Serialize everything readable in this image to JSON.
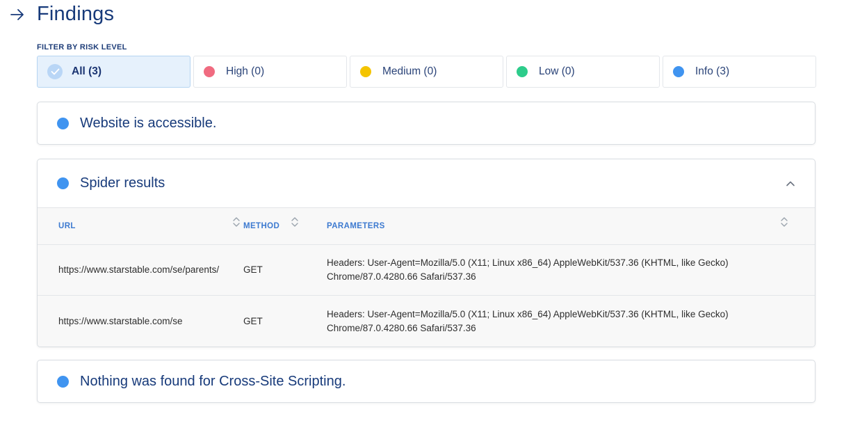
{
  "header": {
    "title": "Findings"
  },
  "filter": {
    "label": "FILTER BY RISK LEVEL",
    "options": [
      {
        "label": "All (3)",
        "color": "#b9d6f6",
        "active": true
      },
      {
        "label": "High (0)",
        "color": "#f06b80"
      },
      {
        "label": "Medium (0)",
        "color": "#f4c400"
      },
      {
        "label": "Low (0)",
        "color": "#2dcc8b"
      },
      {
        "label": "Info (3)",
        "color": "#4094f0"
      }
    ]
  },
  "findings": [
    {
      "title": "Website is accessible."
    },
    {
      "title": "Spider results",
      "table": {
        "headers": {
          "url": "URL",
          "method": "METHOD",
          "parameters": "PARAMETERS"
        },
        "rows": [
          {
            "url": "https://www.starstable.com/se/parents/",
            "method": "GET",
            "parameters": "Headers: User-Agent=Mozilla/5.0 (X11; Linux x86_64) AppleWebKit/537.36 (KHTML, like Gecko) Chrome/87.0.4280.66 Safari/537.36"
          },
          {
            "url": "https://www.starstable.com/se",
            "method": "GET",
            "parameters": "Headers: User-Agent=Mozilla/5.0 (X11; Linux x86_64) AppleWebKit/537.36 (KHTML, like Gecko) Chrome/87.0.4280.66 Safari/537.36"
          }
        ]
      }
    },
    {
      "title": "Nothing was found for Cross-Site Scripting."
    }
  ],
  "colors": {
    "info": "#4094f0",
    "accent": "#173a7a"
  },
  "icons": {
    "back": "arrow-right-icon",
    "collapse": "chevron-up-icon",
    "sort": "sort-icon",
    "check": "check-icon"
  }
}
